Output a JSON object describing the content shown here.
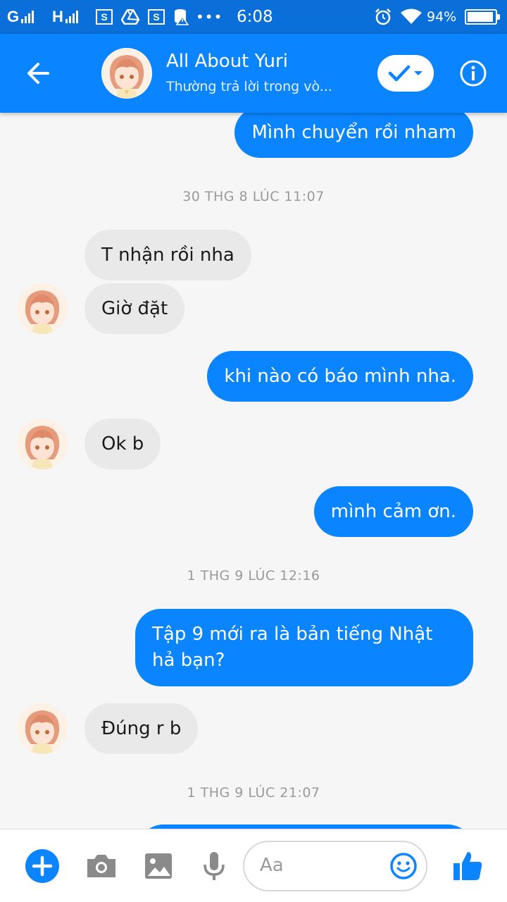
{
  "status_bar": {
    "carrier1": "G",
    "carrier2": "H",
    "sim_badge": "S",
    "sim_badge2": "S",
    "more": "•••",
    "time": "6:08",
    "battery": "94%"
  },
  "header": {
    "title": "All About Yuri",
    "subtitle": "Thường trả lời trong vò..."
  },
  "messages": [
    {
      "type": "out",
      "text": "Mình chuyển rồi nham"
    },
    {
      "type": "timestamp",
      "text": "30 THG 8 LÚC 11:07"
    },
    {
      "type": "in",
      "text": "T nhận rồi nha"
    },
    {
      "type": "in",
      "text": "Giờ đặt"
    },
    {
      "type": "out",
      "text": "khi nào có báo mình nha."
    },
    {
      "type": "in",
      "text": "Ok b"
    },
    {
      "type": "out",
      "text": "mình cảm ơn."
    },
    {
      "type": "timestamp",
      "text": "1 THG 9 LÚC 12:16"
    },
    {
      "type": "out",
      "text": "Tập 9 mới ra là bản tiếng Nhật hả bạn?"
    },
    {
      "type": "in",
      "text": "Đúng r b"
    },
    {
      "type": "timestamp",
      "text": "1 THG 9 LÚC 21:07"
    }
  ],
  "composer": {
    "placeholder": "Aa",
    "icons": [
      "plus-icon",
      "camera-icon",
      "gallery-icon",
      "microphone-icon",
      "emoji-icon",
      "like-icon"
    ]
  },
  "colors": {
    "accent": "#0a84ff",
    "status_bar": "#0a6fd9",
    "incoming_bubble": "#e9e9e9",
    "background": "#f6f6f6"
  }
}
